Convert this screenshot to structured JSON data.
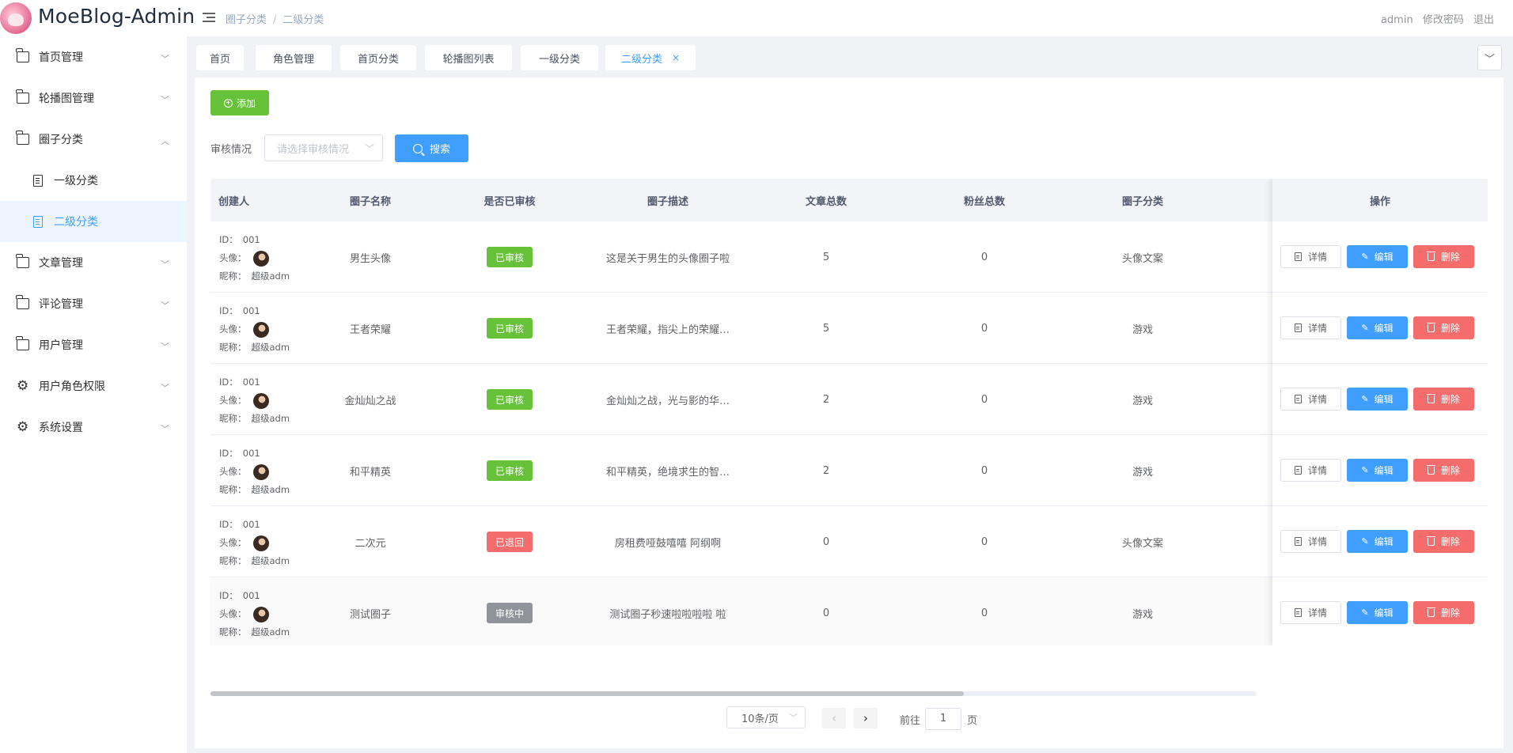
{
  "header": {
    "brand": "MoeBlog-Admin",
    "breadcrumb": [
      "圈子分类",
      "二级分类"
    ],
    "user": "admin",
    "change_password": "修改密码",
    "logout": "退出"
  },
  "sidebar": {
    "items": [
      {
        "label": "首页管理",
        "icon": "folder-icon"
      },
      {
        "label": "轮播图管理",
        "icon": "folder-icon"
      },
      {
        "label": "圈子分类",
        "icon": "folder-icon",
        "expanded": true
      },
      {
        "label": "文章管理",
        "icon": "folder-icon"
      },
      {
        "label": "评论管理",
        "icon": "folder-icon"
      },
      {
        "label": "用户管理",
        "icon": "folder-icon"
      },
      {
        "label": "用户角色权限",
        "icon": "gear-icon"
      },
      {
        "label": "系统设置",
        "icon": "gear-icon"
      }
    ],
    "sub_items": [
      {
        "label": "一级分类",
        "active": false
      },
      {
        "label": "二级分类",
        "active": true
      }
    ]
  },
  "tags": [
    {
      "label": "首页"
    },
    {
      "label": "角色管理"
    },
    {
      "label": "首页分类"
    },
    {
      "label": "轮播图列表"
    },
    {
      "label": "一级分类"
    },
    {
      "label": "二级分类",
      "active": true
    }
  ],
  "toolbar": {
    "add_label": "添加",
    "filter_label": "审核情况",
    "filter_placeholder": "请选择审核情况",
    "search_label": "搜索"
  },
  "table": {
    "columns": [
      "创建人",
      "圈子名称",
      "是否已审核",
      "圈子描述",
      "文章总数",
      "粉丝总数",
      "圈子分类",
      "操作"
    ],
    "creator_labels": {
      "id": "ID：",
      "avatar": "头像：",
      "nickname": "昵称："
    },
    "rows": [
      {
        "id": "001",
        "nickname": "超级adm",
        "name": "男生头像",
        "status": "已审核",
        "description": "这是关于男生的头像圈子啦",
        "articles": "5",
        "fans": "0",
        "category": "头像文案"
      },
      {
        "id": "001",
        "nickname": "超级adm",
        "name": "王者荣耀",
        "status": "已审核",
        "description": "王者荣耀，指尖上的荣耀…",
        "articles": "5",
        "fans": "0",
        "category": "游戏"
      },
      {
        "id": "001",
        "nickname": "超级adm",
        "name": "金灿灿之战",
        "status": "已审核",
        "description": "金灿灿之战，光与影的华…",
        "articles": "2",
        "fans": "0",
        "category": "游戏"
      },
      {
        "id": "001",
        "nickname": "超级adm",
        "name": "和平精英",
        "status": "已审核",
        "description": "和平精英，绝境求生的智…",
        "articles": "2",
        "fans": "0",
        "category": "游戏"
      },
      {
        "id": "001",
        "nickname": "超级adm",
        "name": "二次元",
        "status": "已退回",
        "description": "房租费哑鼓嘻嘻 阿纲啊",
        "articles": "0",
        "fans": "0",
        "category": "头像文案"
      },
      {
        "id": "001",
        "nickname": "超级adm",
        "name": "测试圈子",
        "status": "审核中",
        "description": "测试圈子秒速啦啦啦啦 啦",
        "articles": "0",
        "fans": "0",
        "category": "游戏"
      }
    ],
    "actions": {
      "detail": "详情",
      "edit": "编辑",
      "delete": "删除"
    }
  },
  "status_colors": {
    "已审核": "#67c23a",
    "已退回": "#f56c6c",
    "审核中": "#909399"
  },
  "pagination": {
    "page_size": "10条/页",
    "goto_label": "前往",
    "current_page": "1",
    "page_unit": "页"
  }
}
